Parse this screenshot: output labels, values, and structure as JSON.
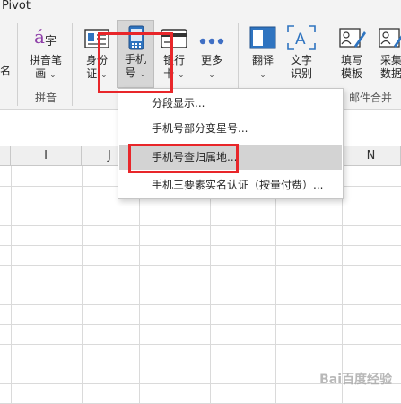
{
  "tab": {
    "label": "Pivot"
  },
  "ribbon": {
    "partial_left_label": "名",
    "pinyin": {
      "label_line1": "拼音笔",
      "label_line2": "画"
    },
    "idcard": {
      "label_line1": "身份",
      "label_line2": "证"
    },
    "phone": {
      "label_line1": "手机",
      "label_line2": "号"
    },
    "bank": {
      "label_line1": "银行",
      "label_line2": "卡"
    },
    "more": {
      "label": "更多"
    },
    "translate": {
      "label": "翻译"
    },
    "ocr": {
      "label_line1": "文字",
      "label_line2": "识别"
    },
    "template": {
      "label_line1": "填写",
      "label_line2": "模板"
    },
    "collect": {
      "label_line1": "采集",
      "label_line2": "数据"
    },
    "groups": {
      "pinyin": "拼音",
      "mail_merge": "邮件合并"
    }
  },
  "dropdown": {
    "items": [
      {
        "label": "分段显示..."
      },
      {
        "label": "手机号部分变星号..."
      },
      {
        "label": "手机号查归属地..."
      },
      {
        "label": "手机三要素实名认证（按量付费）..."
      }
    ],
    "highlighted_index": 2
  },
  "columns": [
    "I",
    "J",
    "N"
  ],
  "watermark": "Bai百度经验",
  "colors": {
    "highlight_box": "#e8262a",
    "menu_highlight": "#d3d3d3"
  }
}
